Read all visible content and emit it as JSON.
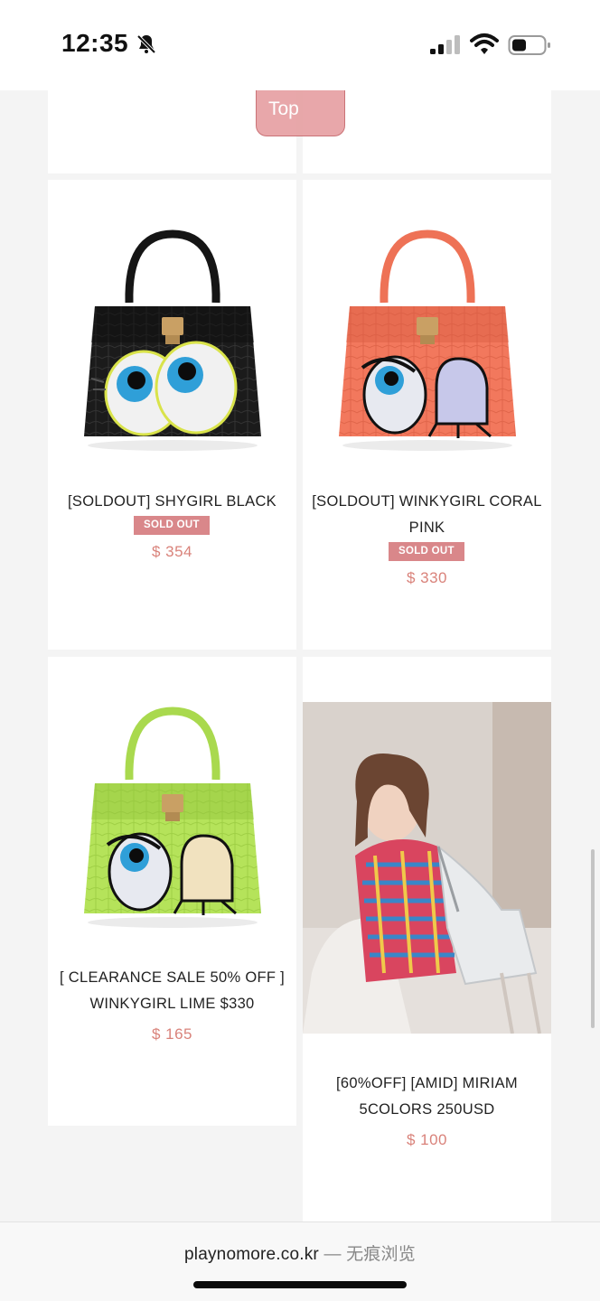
{
  "status_bar": {
    "time": "12:35",
    "icons": [
      "bell-slash-icon",
      "cellular-signal-icon",
      "wifi-icon",
      "battery-icon"
    ]
  },
  "top_button": {
    "label": "Top"
  },
  "products": [
    {
      "title": "[SOLDOUT] SHYGIRL BLACK",
      "badge": "SOLD OUT",
      "price": "$ 354",
      "image": "black-handbag-eyes",
      "bag_color": "#1b1b1b"
    },
    {
      "title": "[SOLDOUT] WINKYGIRL CORAL PINK",
      "badge": "SOLD OUT",
      "price": "$ 330",
      "image": "coral-handbag-eyes",
      "bag_color": "#f2785d"
    },
    {
      "title": "[ CLEARANCE SALE 50% OFF ] WINKYGIRL LIME $330",
      "badge": "",
      "price": "$ 165",
      "image": "lime-handbag-eyes",
      "bag_color": "#b5e35a"
    },
    {
      "title": "[60%OFF] [AMID] MIRIAM 5COLORS 250USD",
      "badge": "",
      "price": "$ 100",
      "image": "model-with-grey-bag-photo",
      "bag_color": "#d8dadc"
    }
  ],
  "bottom_bar": {
    "domain": "playnomore.co.kr",
    "separator": "—",
    "mode": "无痕浏览"
  },
  "colors": {
    "accent_pink": "#d9878a",
    "price": "#d9827a",
    "background": "#f4f4f4"
  }
}
